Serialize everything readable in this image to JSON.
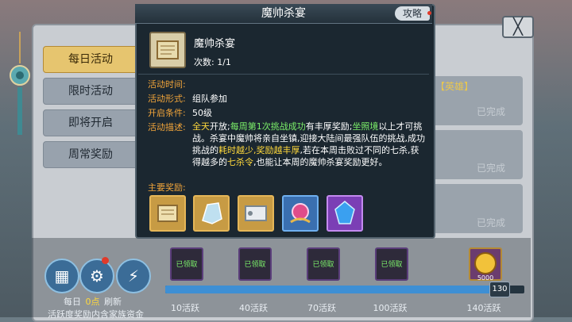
{
  "tabs": [
    {
      "label": "每日活动",
      "active": true
    },
    {
      "label": "限时活动",
      "active": false
    },
    {
      "label": "即将开启",
      "active": false
    },
    {
      "label": "周常奖励",
      "active": false
    }
  ],
  "list_rows": [
    {
      "status": "已完成",
      "tag": "【英雄】"
    },
    {
      "status": "已完成",
      "tag": ""
    },
    {
      "status": "已完成",
      "tag": ""
    }
  ],
  "close_label": "╳",
  "modal": {
    "title": "魔帅杀宴",
    "guide_label": "攻略",
    "item_name": "魔帅杀宴",
    "count_label": "次数: 1/1",
    "time_key": "活动时间:",
    "form_key": "活动形式:",
    "form_val": "组队参加",
    "cond_key": "开启条件:",
    "cond_val": "50级",
    "desc_key": "活动描述:",
    "desc_parts": {
      "p1": "全天",
      "p2": "开放;",
      "p3": "每周第1次挑战成功",
      "p4": "有丰厚奖励;",
      "p5": "坐照境",
      "p6": "以上才可挑战。杀宴中魔帅将亲自坐镇,迎接大陆间最强队伍的挑战,成功挑战的",
      "p7": "耗时越少,奖励越丰厚",
      "p8": ",若在本周击败过不同的七杀,获得越多的",
      "p9": "七杀令",
      "p10": ",也能让本周的魔帅杀宴奖励更好。"
    },
    "rewards_label": "主要奖励:"
  },
  "bottom": {
    "daily_label": "每日",
    "daily_time": "0点",
    "refresh_label": "刷新",
    "footer_text": "活跃度奖励内含家族资金"
  },
  "progress": {
    "value": 130,
    "max": 140,
    "badge": "130",
    "milestones": [
      "10活跃",
      "40活跃",
      "70活跃",
      "100活跃",
      "140活跃"
    ],
    "milestone_badge": "已领取",
    "last_badge": "5000"
  },
  "colors": {
    "accent": "#e6c56f",
    "highlight_green": "#7cf06a",
    "highlight_yellow": "#ffd93c",
    "highlight_orange": "#f2a53a"
  }
}
